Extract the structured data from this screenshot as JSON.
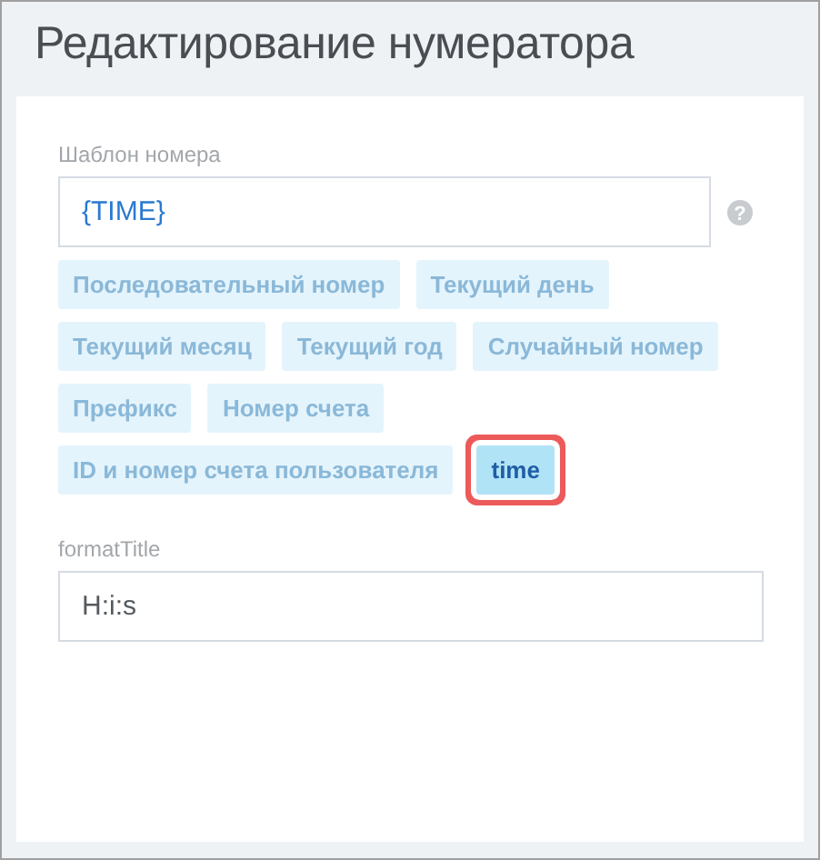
{
  "title": "Редактирование нумератора",
  "template": {
    "label": "Шаблон номера",
    "value": "{TIME}",
    "help": "?"
  },
  "tags": [
    {
      "label": "Последовательный номер",
      "selected": false
    },
    {
      "label": "Текущий день",
      "selected": false
    },
    {
      "label": "Текущий месяц",
      "selected": false
    },
    {
      "label": "Текущий год",
      "selected": false
    },
    {
      "label": "Случайный номер",
      "selected": false
    },
    {
      "label": "Префикс",
      "selected": false
    },
    {
      "label": "Номер счета",
      "selected": false
    },
    {
      "label": "ID и номер счета пользователя",
      "selected": false
    },
    {
      "label": "time",
      "selected": true
    }
  ],
  "format": {
    "label": "formatTitle",
    "value": "H:i:s"
  }
}
